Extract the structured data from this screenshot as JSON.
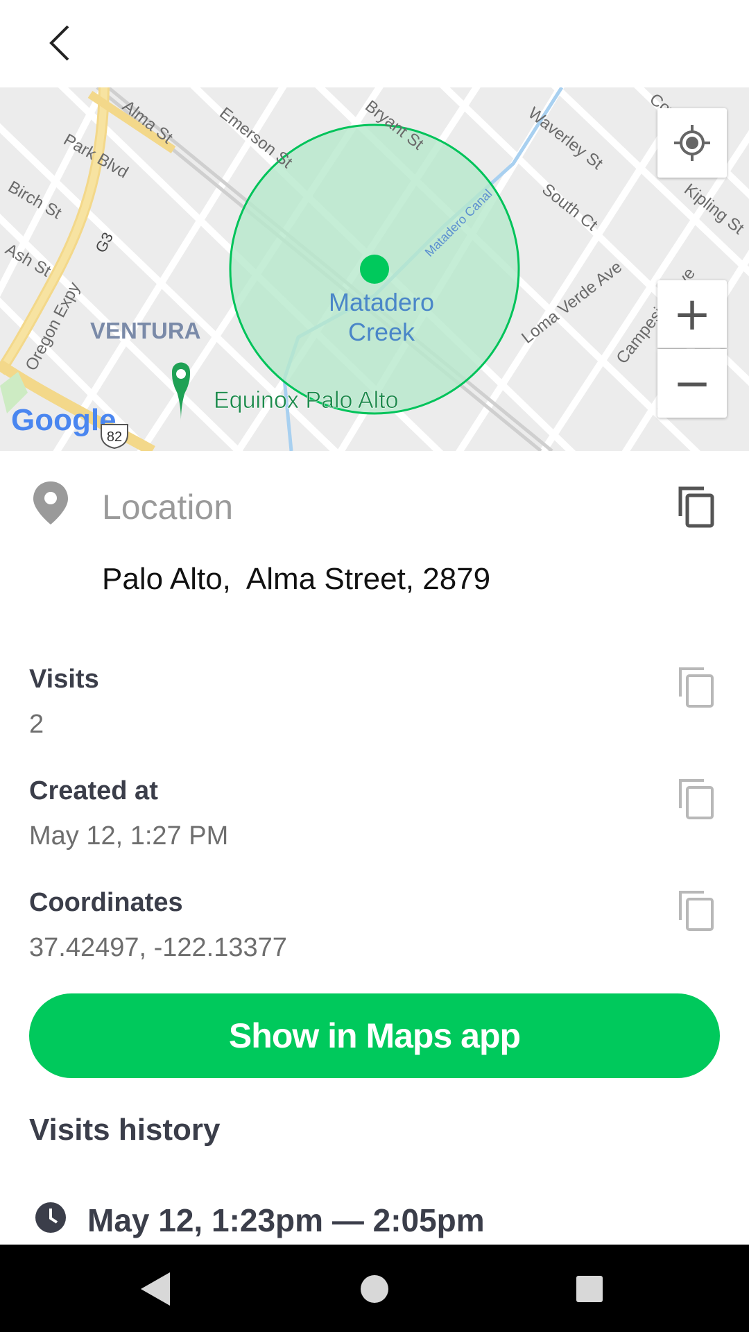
{
  "map": {
    "area_label": "VENTURA",
    "poi_label": "Equinox Palo Alto",
    "creek_label_line1": "Matadero",
    "creek_label_line2": "Creek",
    "canal_label": "Matadero Canal",
    "google_logo": "Google",
    "route_shield": "82",
    "highway_label": "G3",
    "streets": {
      "alma": "Alma St",
      "emerson": "Emerson St",
      "bryant": "Bryant St",
      "waverley": "Waverley St",
      "cowper": "Cowper St",
      "kipling": "Kipling St",
      "park": "Park Blvd",
      "birch": "Birch St",
      "ash": "Ash St",
      "oregon": "Oregon Expy",
      "south": "South Ct",
      "loma": "Loma Verde Ave",
      "campesino": "Campesino Ave"
    },
    "zoom_in_label": "+",
    "zoom_out_label": "−",
    "colors": {
      "geofence_fill": "#b6e8cc",
      "geofence_stroke": "#00c35a",
      "marker": "#00c95c",
      "poi_pin": "#1fa155"
    }
  },
  "location": {
    "title": "Location",
    "address": "Palo Alto,  Alma Street, 2879"
  },
  "visits": {
    "label": "Visits",
    "value": "2"
  },
  "created": {
    "label": "Created at",
    "value": "May 12, 1:27 PM"
  },
  "coordinates": {
    "label": "Coordinates",
    "value": "37.42497, -122.13377"
  },
  "action_button": {
    "label": "Show in Maps app",
    "color": "#00c95c"
  },
  "history": {
    "title": "Visits history",
    "items": [
      {
        "text": "May 12, 1:23pm — 2:05pm"
      }
    ]
  }
}
